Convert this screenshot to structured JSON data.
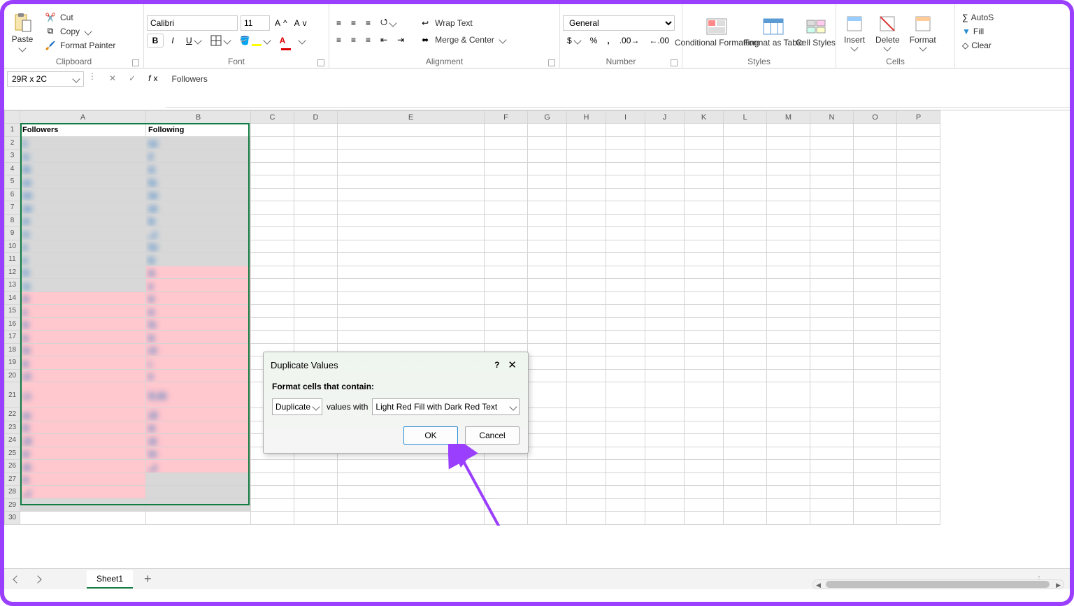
{
  "ribbon": {
    "clipboard": {
      "label": "Clipboard",
      "paste": "Paste",
      "cut": "Cut",
      "copy": "Copy",
      "painter": "Format Painter"
    },
    "font": {
      "label": "Font",
      "name": "Calibri",
      "size": "11"
    },
    "alignment": {
      "label": "Alignment",
      "wrap": "Wrap Text",
      "merge": "Merge & Center"
    },
    "number": {
      "label": "Number",
      "format": "General"
    },
    "styles": {
      "label": "Styles",
      "cf": "Conditional\nFormatting",
      "fat": "Format as\nTable",
      "cs": "Cell\nStyles"
    },
    "cells": {
      "label": "Cells",
      "insert": "Insert",
      "delete": "Delete",
      "format": "Format"
    },
    "editing": {
      "autosum": "AutoS",
      "fill": "Fill",
      "clear": "Clear"
    }
  },
  "formula": {
    "namebox": "29R x 2C",
    "value": "Followers"
  },
  "headers": [
    "A",
    "B",
    "C",
    "D",
    "E",
    "F",
    "G",
    "H",
    "I",
    "J",
    "K",
    "L",
    "M",
    "N",
    "O",
    "P"
  ],
  "colA_header": "Followers",
  "colB_header": "Following",
  "rows": [
    {
      "r": 2,
      "a": "h",
      "b": "mr",
      "fa": false,
      "fb": false
    },
    {
      "r": 3,
      "a": "m",
      "b": "4",
      "fa": false,
      "fb": false
    },
    {
      "r": 4,
      "a": "kk",
      "b": "sr",
      "fa": false,
      "fb": false
    },
    {
      "r": 5,
      "a": "sp",
      "b": "its",
      "fa": false,
      "fb": false
    },
    {
      "r": 6,
      "a": "pa",
      "b": "na",
      "fa": false,
      "fb": false
    },
    {
      "r": 7,
      "a": "ga",
      "b": "ya",
      "fa": false,
      "fb": false
    },
    {
      "r": 8,
      "a": "ar",
      "b": "la",
      "fa": false,
      "fb": false
    },
    {
      "r": 9,
      "a": "m",
      "b": "_s",
      "fa": false,
      "fb": false
    },
    {
      "r": 10,
      "a": "a",
      "b": "ho",
      "fa": false,
      "fb": false
    },
    {
      "r": 11,
      "a": "a",
      "b": "kr",
      "fa": false,
      "fb": false
    },
    {
      "r": 12,
      "a": "th",
      "b": "ja",
      "fa": false,
      "fb": true
    },
    {
      "r": 13,
      "a": "ra",
      "b": "a",
      "fa": false,
      "fb": true
    },
    {
      "r": 14,
      "a": "ja",
      "b": "w",
      "fa": true,
      "fb": true
    },
    {
      "r": 15,
      "a": "a",
      "b": "w",
      "fa": true,
      "fb": true
    },
    {
      "r": 16,
      "a": "la",
      "b": "lis",
      "fa": true,
      "fb": true
    },
    {
      "r": 17,
      "a": "w",
      "b": "je",
      "fa": true,
      "fb": true
    },
    {
      "r": 18,
      "a": "lis",
      "b": "ch",
      "fa": true,
      "fb": true
    },
    {
      "r": 19,
      "a": "je",
      "b": "i.",
      "fa": true,
      "fb": true
    },
    {
      "r": 20,
      "a": "ch",
      "b": "a",
      "fa": true,
      "fb": true
    },
    {
      "r": 21,
      "a": "i.s",
      "b": "th\nbh",
      "fa": true,
      "fb": true,
      "tall": true
    },
    {
      "r": 22,
      "a": "ac",
      "b": "18",
      "fa": true,
      "fb": true
    },
    {
      "r": 23,
      "a": "th",
      "b": "pr",
      "fa": true,
      "fb": true
    },
    {
      "r": 24,
      "a": "18",
      "b": "sh",
      "fa": true,
      "fb": true
    },
    {
      "r": 25,
      "a": "pr",
      "b": "im",
      "fa": true,
      "fb": true
    },
    {
      "r": 26,
      "a": "sh",
      "b": "_s",
      "fa": true,
      "fb": true
    },
    {
      "r": 27,
      "a": "in",
      "b": "",
      "fa": true,
      "fb": false
    },
    {
      "r": 28,
      "a": "_v",
      "b": "",
      "fa": true,
      "fb": false
    }
  ],
  "dialog": {
    "title": "Duplicate Values",
    "subtitle": "Format cells that contain:",
    "mode": "Duplicate",
    "valueswith": "values with",
    "format": "Light Red Fill with Dark Red Text",
    "ok": "OK",
    "cancel": "Cancel"
  },
  "sheetbar": {
    "sheet": "Sheet1"
  }
}
